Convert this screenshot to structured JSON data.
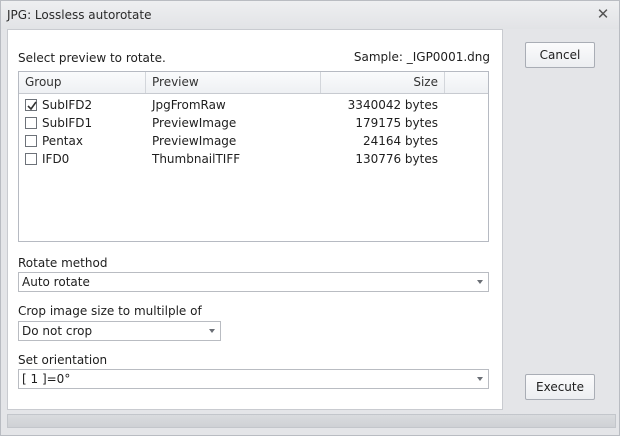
{
  "window": {
    "title": "JPG: Lossless autorotate"
  },
  "header": {
    "instruction": "Select preview to rotate.",
    "sample": "Sample: _IGP0001.dng"
  },
  "table": {
    "columns": [
      "Group",
      "Preview",
      "Size"
    ],
    "rows": [
      {
        "group": "SubIFD2",
        "preview": "JpgFromRaw",
        "size": "3340042 bytes",
        "checked": true
      },
      {
        "group": "SubIFD1",
        "preview": "PreviewImage",
        "size": "179175 bytes",
        "checked": false
      },
      {
        "group": "Pentax",
        "preview": "PreviewImage",
        "size": "24164 bytes",
        "checked": false
      },
      {
        "group": "IFD0",
        "preview": "ThumbnailTIFF",
        "size": "130776 bytes",
        "checked": false
      }
    ]
  },
  "rotate": {
    "label": "Rotate method",
    "value": "Auto rotate"
  },
  "crop": {
    "label": "Crop image size to multilple of",
    "value": "Do not crop"
  },
  "orientation": {
    "label": "Set orientation",
    "value": "[ 1 ]=0°"
  },
  "buttons": {
    "cancel": "Cancel",
    "execute": "Execute"
  },
  "icons": {
    "close": "close-icon",
    "check": "checkmark-icon",
    "dropdown": "chevron-down-icon"
  }
}
